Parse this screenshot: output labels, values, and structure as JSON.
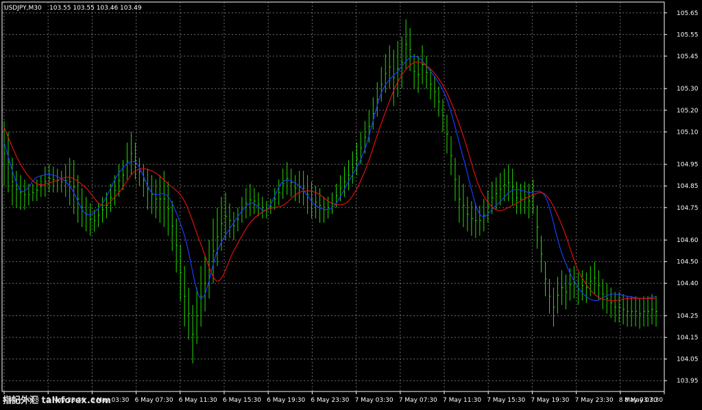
{
  "header": {
    "symbol": "USDJPY,M30",
    "ohlc": "103.55 103.55 103.46 103.49"
  },
  "watermark": "指記外汇 talkforex.com",
  "colors": {
    "background": "#000000",
    "grid": "#c8c8c8",
    "bars": "#22e000",
    "ma_fast": "#1a3cff",
    "ma_slow": "#e01010",
    "text": "#ffffff"
  },
  "chart_data": {
    "type": "line",
    "ylim": [
      103.9,
      105.7
    ],
    "y_ticks": [
      "105.65",
      "105.55",
      "105.45",
      "105.30",
      "105.20",
      "105.10",
      "104.95",
      "104.85",
      "104.75",
      "104.60",
      "104.50",
      "104.40",
      "104.25",
      "104.15",
      "104.05",
      "103.95"
    ],
    "x_ticks": [
      "5 May 2008",
      "5 May 23:30",
      "6 May 03:30",
      "6 May 07:30",
      "6 May 11:30",
      "6 May 15:30",
      "6 May 19:30",
      "6 May 23:30",
      "7 May 03:30",
      "7 May 07:30",
      "7 May 11:30",
      "7 May 15:30",
      "7 May 19:30",
      "7 May 23:30",
      "8 May 03:30",
      "8 May 07:30"
    ],
    "grid": true,
    "series": [
      {
        "kind": "bars",
        "x": [
          0,
          1,
          2,
          3,
          4,
          5,
          6,
          7,
          8,
          9,
          10,
          11,
          12,
          13,
          14,
          15,
          16,
          17,
          18,
          19,
          20,
          21,
          22,
          23,
          24,
          25,
          26,
          27,
          28,
          29,
          30,
          31,
          32,
          33,
          34,
          35,
          36,
          37,
          38,
          39,
          40,
          41,
          42,
          43,
          44,
          45,
          46,
          47,
          48,
          49,
          50,
          51,
          52,
          53,
          54,
          55,
          56,
          57,
          58,
          59,
          60,
          61,
          62,
          63,
          64,
          65,
          66,
          67,
          68,
          69,
          70,
          71,
          72,
          73,
          74,
          75,
          76,
          77,
          78,
          79,
          80,
          81,
          82,
          83,
          84,
          85,
          86,
          87,
          88,
          89,
          90,
          91,
          92,
          93,
          94,
          95,
          96,
          97,
          98,
          99,
          100,
          101,
          102,
          103,
          104,
          105,
          106,
          107,
          108,
          109,
          110,
          111,
          112,
          113,
          114,
          115,
          116,
          117,
          118,
          119,
          120,
          121,
          122,
          123,
          124,
          125,
          126,
          127,
          128,
          129,
          130,
          131,
          132,
          133,
          134,
          135,
          136,
          137,
          138,
          139,
          140,
          141,
          142,
          143,
          144,
          145,
          146,
          147,
          148,
          149,
          150,
          151,
          152,
          153,
          154,
          155,
          156,
          157,
          158,
          159
        ],
        "high": [
          105.15,
          105.1,
          104.98,
          104.92,
          104.9,
          104.88,
          104.86,
          104.86,
          104.88,
          104.9,
          104.94,
          104.95,
          104.94,
          104.93,
          104.92,
          104.95,
          104.98,
          104.97,
          104.9,
          104.84,
          104.8,
          104.77,
          104.74,
          104.77,
          104.8,
          104.82,
          104.86,
          104.9,
          104.95,
          104.97,
          105.05,
          105.1,
          105.05,
          104.98,
          104.95,
          104.93,
          104.9,
          104.88,
          104.9,
          104.92,
          104.87,
          104.78,
          104.7,
          104.58,
          104.48,
          104.38,
          104.3,
          104.38,
          104.48,
          104.53,
          104.6,
          104.7,
          104.75,
          104.8,
          104.82,
          104.77,
          104.73,
          104.75,
          104.8,
          104.84,
          104.86,
          104.84,
          104.82,
          104.8,
          104.78,
          104.79,
          104.84,
          104.88,
          104.93,
          104.96,
          104.93,
          104.9,
          104.92,
          104.92,
          104.9,
          104.87,
          104.85,
          104.84,
          104.8,
          104.8,
          104.82,
          104.86,
          104.9,
          104.94,
          104.97,
          105.01,
          105.05,
          105.1,
          105.15,
          105.2,
          105.26,
          105.33,
          105.4,
          105.46,
          105.5,
          105.48,
          105.52,
          105.54,
          105.62,
          105.58,
          105.46,
          105.45,
          105.5,
          105.45,
          105.39,
          105.36,
          105.31,
          105.25,
          105.18,
          105.08,
          104.98,
          104.9,
          104.86,
          104.8,
          104.78,
          104.77,
          104.76,
          104.79,
          104.83,
          104.87,
          104.89,
          104.91,
          104.93,
          104.95,
          104.93,
          104.87,
          104.86,
          104.87,
          104.86,
          104.88,
          104.76,
          104.62,
          104.5,
          104.42,
          104.38,
          104.43,
          104.46,
          104.44,
          104.47,
          104.48,
          104.45,
          104.46,
          104.45,
          104.48,
          104.5,
          104.46,
          104.42,
          104.4,
          104.38,
          104.36,
          104.36,
          104.35,
          104.34,
          104.34,
          104.34,
          104.33,
          104.34,
          104.34,
          104.35,
          104.34
        ],
        "low": [
          104.85,
          104.82,
          104.76,
          104.75,
          104.74,
          104.74,
          104.76,
          104.78,
          104.78,
          104.8,
          104.8,
          104.82,
          104.82,
          104.82,
          104.82,
          104.8,
          104.76,
          104.72,
          104.68,
          104.66,
          104.64,
          104.62,
          104.64,
          104.66,
          104.68,
          104.7,
          104.73,
          104.76,
          104.8,
          104.83,
          104.88,
          104.9,
          104.88,
          104.85,
          104.8,
          104.74,
          104.72,
          104.7,
          104.68,
          104.66,
          104.62,
          104.55,
          104.45,
          104.32,
          104.2,
          104.14,
          104.03,
          104.12,
          104.2,
          104.27,
          104.33,
          104.4,
          104.48,
          104.55,
          104.6,
          104.61,
          104.6,
          104.64,
          104.68,
          104.7,
          104.71,
          104.72,
          104.71,
          104.7,
          104.7,
          104.72,
          104.74,
          104.76,
          104.79,
          104.81,
          104.8,
          104.78,
          104.77,
          104.76,
          104.72,
          104.7,
          104.7,
          104.68,
          104.68,
          104.7,
          104.72,
          104.75,
          104.78,
          104.8,
          104.83,
          104.86,
          104.9,
          104.95,
          105.0,
          105.05,
          105.11,
          105.17,
          105.24,
          105.28,
          105.3,
          105.22,
          105.26,
          105.3,
          105.39,
          105.38,
          105.3,
          105.28,
          105.32,
          105.3,
          105.25,
          105.21,
          105.17,
          105.1,
          105.0,
          104.9,
          104.78,
          104.68,
          104.66,
          104.64,
          104.62,
          104.61,
          104.62,
          104.64,
          104.68,
          104.72,
          104.74,
          104.76,
          104.78,
          104.78,
          104.76,
          104.72,
          104.72,
          104.72,
          104.7,
          104.72,
          104.56,
          104.45,
          104.34,
          104.26,
          104.2,
          104.26,
          104.3,
          104.28,
          104.32,
          104.33,
          104.3,
          104.32,
          104.31,
          104.34,
          104.35,
          104.32,
          104.28,
          104.26,
          104.24,
          104.22,
          104.22,
          104.21,
          104.2,
          104.2,
          104.2,
          104.19,
          104.2,
          104.2,
          104.21,
          104.2
        ]
      },
      {
        "name": "",
        "kind": "ma_fast",
        "x": [
          0,
          4,
          8,
          12,
          16,
          20,
          24,
          28,
          32,
          36,
          40,
          44,
          48,
          52,
          56,
          60,
          64,
          68,
          72,
          76,
          80,
          84,
          88,
          92,
          96,
          100,
          104,
          108,
          112,
          116,
          120,
          124,
          128,
          132,
          136,
          140,
          144,
          148,
          152,
          156,
          159
        ],
        "y": [
          105.05,
          104.83,
          104.89,
          104.9,
          104.85,
          104.72,
          104.77,
          104.91,
          104.96,
          104.82,
          104.8,
          104.62,
          104.33,
          104.55,
          104.68,
          104.77,
          104.74,
          104.87,
          104.85,
          104.76,
          104.75,
          104.87,
          105.02,
          105.28,
          105.38,
          105.45,
          105.38,
          105.25,
          104.98,
          104.72,
          104.76,
          104.83,
          104.82,
          104.8,
          104.54,
          104.38,
          104.32,
          104.35,
          104.34,
          104.33,
          104.34
        ]
      },
      {
        "name": "",
        "kind": "ma_slow",
        "x": [
          0,
          4,
          8,
          12,
          16,
          20,
          24,
          28,
          32,
          36,
          40,
          44,
          48,
          52,
          56,
          60,
          64,
          68,
          72,
          76,
          80,
          84,
          88,
          92,
          96,
          100,
          104,
          108,
          112,
          116,
          120,
          124,
          128,
          132,
          136,
          140,
          144,
          148,
          152,
          156,
          159
        ],
        "y": [
          105.12,
          104.95,
          104.86,
          104.87,
          104.89,
          104.84,
          104.76,
          104.82,
          104.92,
          104.92,
          104.86,
          104.78,
          104.58,
          104.41,
          104.55,
          104.68,
          104.74,
          104.76,
          104.82,
          104.82,
          104.77,
          104.78,
          104.92,
          105.14,
          105.33,
          105.42,
          105.39,
          105.28,
          105.08,
          104.84,
          104.74,
          104.76,
          104.8,
          104.81,
          104.67,
          104.46,
          104.35,
          104.32,
          104.33,
          104.33,
          104.33
        ]
      }
    ]
  }
}
